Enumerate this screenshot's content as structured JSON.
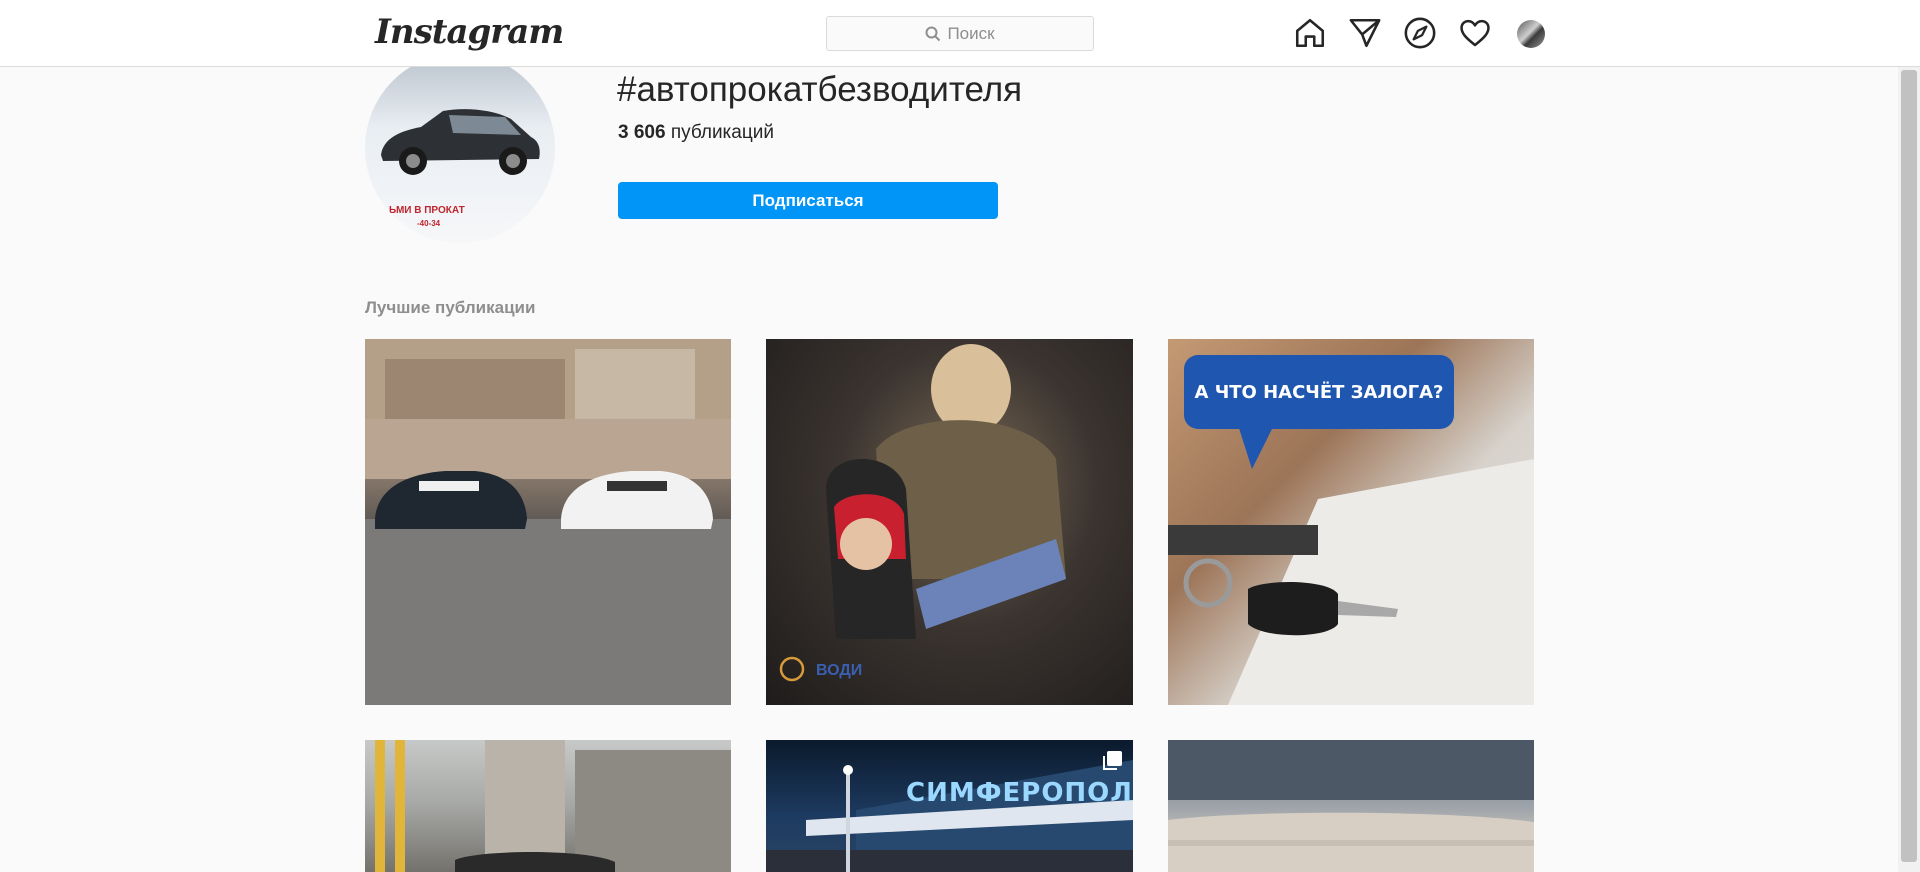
{
  "topbar": {
    "logo_text": "Instagram",
    "search_placeholder": "Поиск",
    "icons": [
      "home-icon",
      "direct-icon",
      "explore-icon",
      "activity-heart-icon",
      "profile-avatar"
    ]
  },
  "tag": {
    "name": "#автопрокатбезводителя",
    "posts_count": "3 606",
    "posts_label": "публикаций",
    "follow_label": "Подписаться",
    "avatar_text_line1": "ЬМИ В ПРОКАТ",
    "avatar_text_line2": "-40-34"
  },
  "section": {
    "top_posts_title": "Лучшие публикации"
  },
  "posts": [
    {
      "kind": "photo",
      "subject": "two-cars"
    },
    {
      "kind": "photo",
      "subject": "child-car-seat",
      "watermark": "ВОДИ"
    },
    {
      "kind": "photo",
      "subject": "car-key-contract",
      "caption": "А ЧТО НАСЧЁТ ЗАЛОГА?"
    },
    {
      "kind": "photo",
      "subject": "car-construction"
    },
    {
      "kind": "carousel",
      "subject": "airport",
      "sign": "СИМФЕРОПОЛЬ"
    },
    {
      "kind": "photo",
      "subject": "seascape"
    }
  ],
  "colors": {
    "accent": "#0095f6",
    "background": "#fafafa",
    "bubble": "#1e56b0"
  }
}
